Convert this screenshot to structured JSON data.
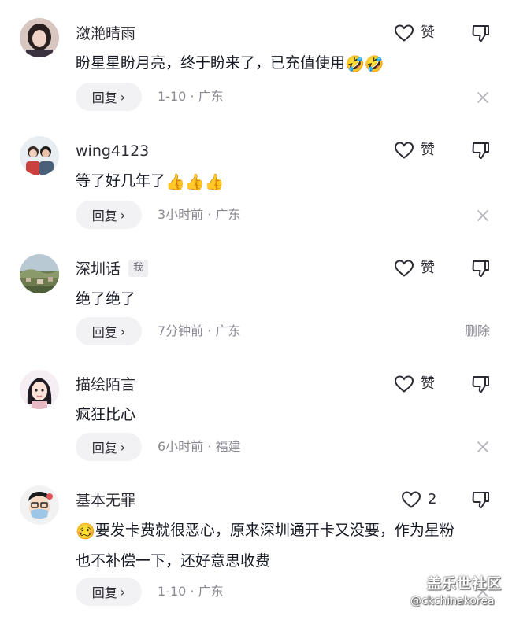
{
  "comments": [
    {
      "username": "潋滟晴雨",
      "text": "盼星星盼月亮，终于盼来了，已充值使用",
      "emojis": "🤣🤣",
      "like_label": "赞",
      "reply_label": "回复",
      "reply_chevron": "›",
      "meta": "1-10 · 广东",
      "avatar_icon": "avatar-woman-photo"
    },
    {
      "username": "wing4123",
      "text": "等了好几年了",
      "emojis": "👍👍👍",
      "like_label": "赞",
      "reply_label": "回复",
      "reply_chevron": "›",
      "meta": "3小时前 · 广东",
      "avatar_icon": "avatar-couple-photo"
    },
    {
      "username": "深圳话",
      "me_tag": "我",
      "text": "绝了绝了",
      "like_label": "赞",
      "reply_label": "回复",
      "reply_chevron": "›",
      "meta": "7分钟前 · 广东",
      "delete_label": "删除",
      "avatar_icon": "avatar-landscape-photo"
    },
    {
      "username": "描绘陌言",
      "text": "疯狂比心",
      "like_label": "赞",
      "reply_label": "回复",
      "reply_chevron": "›",
      "meta": "6小时前 · 福建",
      "avatar_icon": "avatar-cartoon-girl"
    },
    {
      "username": "基本无罪",
      "text_line1": "要发卡费就很恶心，原来深圳通开卡又没要，作为星粉",
      "text_line2": "也不补偿一下，还好意思收费",
      "emojis": "🥴",
      "like_count": "2",
      "reply_label": "回复",
      "reply_chevron": "›",
      "meta": "1-10 · 广东",
      "avatar_icon": "avatar-cartoon-man-mask"
    }
  ],
  "watermark": {
    "site": "盖乐世社区",
    "handle": "@ckchinakorea"
  },
  "colors": {
    "text": "#161823",
    "meta": "#8a8a93",
    "pill_bg": "#f2f2f4"
  }
}
